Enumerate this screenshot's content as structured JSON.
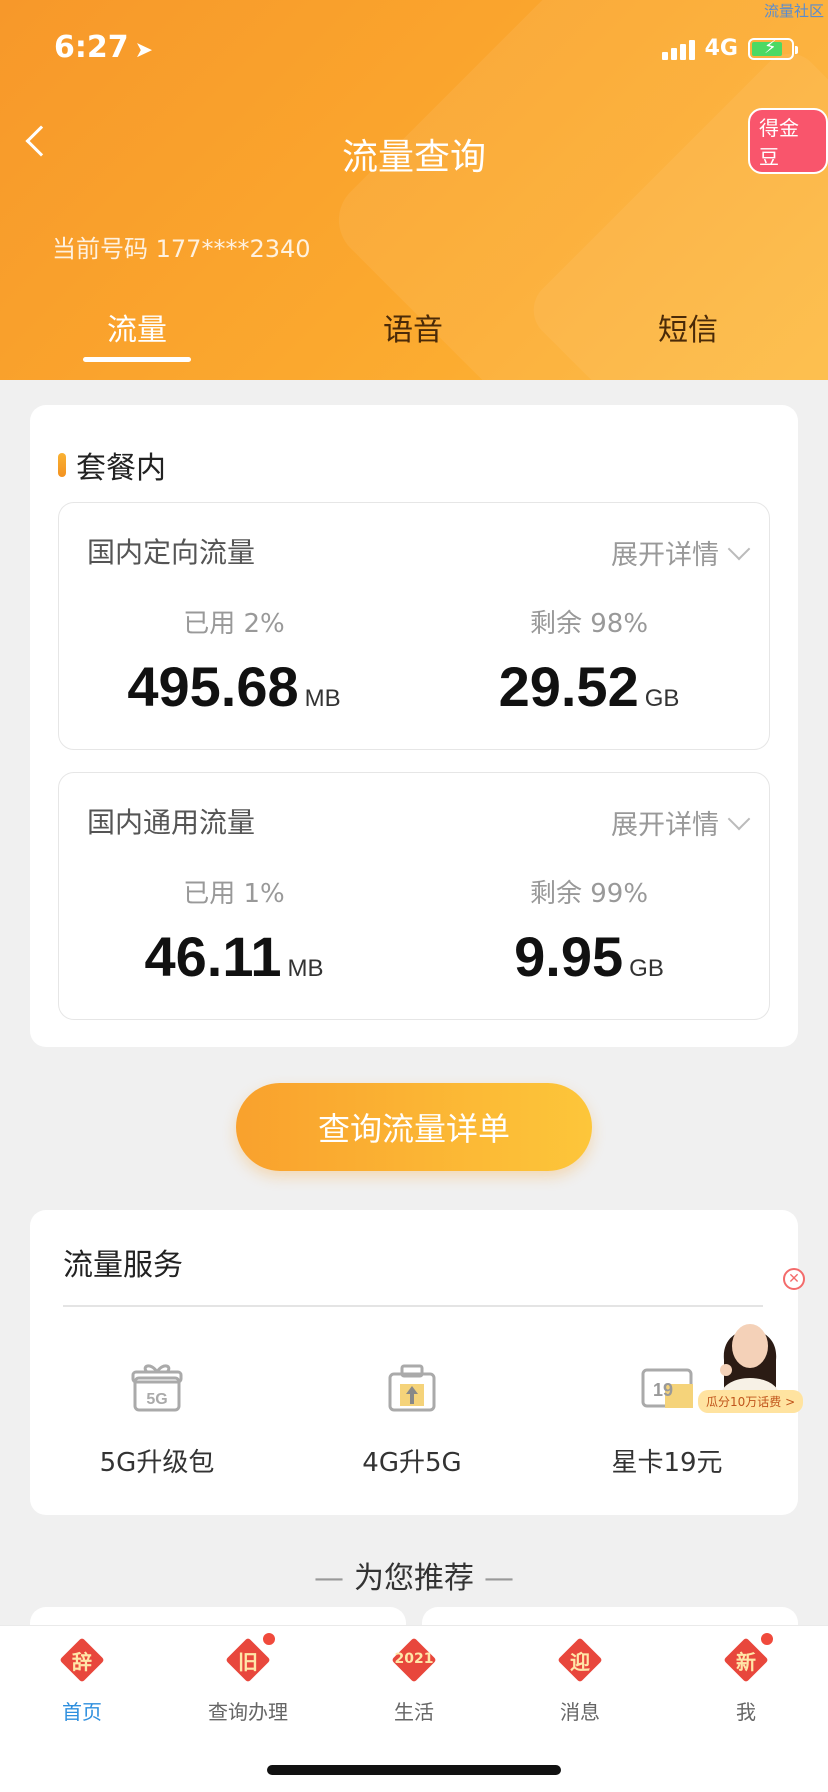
{
  "status_bar": {
    "time": "6:27",
    "network": "4G",
    "watermark": "流量社区"
  },
  "header": {
    "title": "流量查询",
    "gold_badge": "得金豆",
    "phone_label": "当前号码",
    "phone_number": "177****2340"
  },
  "tabs": [
    {
      "label": "流量",
      "active": true
    },
    {
      "label": "语音",
      "active": false
    },
    {
      "label": "短信",
      "active": false
    }
  ],
  "package": {
    "section_title": "套餐内",
    "items": [
      {
        "name": "国内定向流量",
        "expand_label": "展开详情",
        "used_label": "已用 2%",
        "used_value": "495.68",
        "used_unit": "MB",
        "remain_label": "剩余 98%",
        "remain_value": "29.52",
        "remain_unit": "GB"
      },
      {
        "name": "国内通用流量",
        "expand_label": "展开详情",
        "used_label": "已用 1%",
        "used_value": "46.11",
        "used_unit": "MB",
        "remain_label": "剩余 99%",
        "remain_value": "9.95",
        "remain_unit": "GB"
      }
    ]
  },
  "query_button": "查询流量详单",
  "services": {
    "title": "流量服务",
    "items": [
      {
        "label": "5G升级包",
        "icon": "5g-gift-icon",
        "icon_text": "5G"
      },
      {
        "label": "4G升5G",
        "icon": "upgrade-box-icon"
      },
      {
        "label": "星卡19元",
        "icon": "star-card-icon",
        "icon_text": "19"
      }
    ]
  },
  "ad": {
    "tag": "瓜分10万话费 >"
  },
  "recommend_title": "为您推荐",
  "bottom_nav": [
    {
      "label": "首页",
      "icon_char": "辞",
      "active": true,
      "dot": false
    },
    {
      "label": "查询办理",
      "icon_char": "旧",
      "active": false,
      "dot": true
    },
    {
      "label": "生活",
      "icon_char": "2021",
      "active": false,
      "dot": false
    },
    {
      "label": "消息",
      "icon_char": "迎",
      "active": false,
      "dot": false
    },
    {
      "label": "我",
      "icon_char": "新",
      "active": false,
      "dot": true
    }
  ],
  "colors": {
    "header_orange": "#f7982a",
    "accent_yellow": "#fdc63a",
    "active_blue": "#2e8fde",
    "badge_red": "#f9556c"
  }
}
